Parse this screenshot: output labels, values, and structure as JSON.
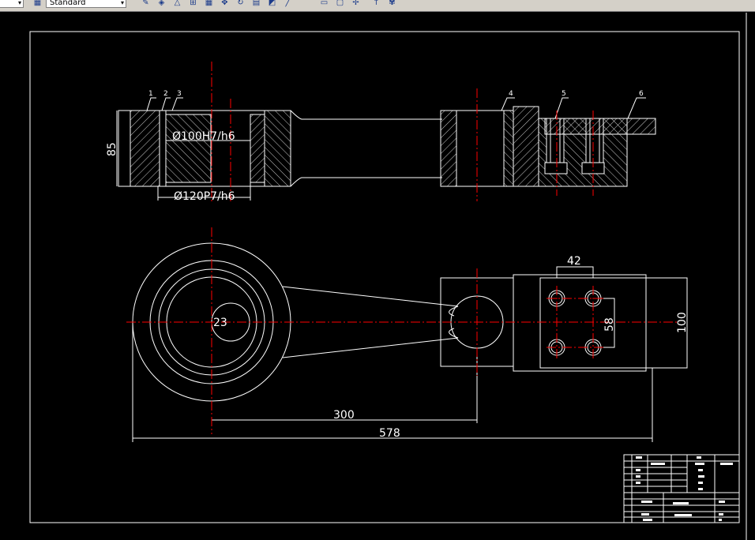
{
  "toolbar": {
    "left_combo_arrow": "▾",
    "style_combo_value": "Standard",
    "style_combo_arrow": "▾",
    "buttons": [
      {
        "icon": "pencil-icon",
        "glyph": "✎"
      },
      {
        "icon": "layer-icon",
        "glyph": "◈"
      },
      {
        "icon": "triangle-icon",
        "glyph": "△"
      },
      {
        "icon": "table-icon",
        "glyph": "⊞"
      },
      {
        "icon": "grid-icon",
        "glyph": "▦"
      },
      {
        "icon": "move-icon",
        "glyph": "✥"
      },
      {
        "icon": "rotate-icon",
        "glyph": "↻"
      },
      {
        "icon": "block-icon",
        "glyph": "▤"
      },
      {
        "icon": "scale-icon",
        "glyph": "◩"
      },
      {
        "icon": "line-icon",
        "glyph": "╱"
      },
      {
        "icon": "arc-icon",
        "glyph": "⌒"
      },
      {
        "icon": "rect-icon",
        "glyph": "▭"
      },
      {
        "icon": "rect2-icon",
        "glyph": "▢"
      },
      {
        "icon": "node-icon",
        "glyph": "✢"
      },
      {
        "icon": "pin-icon",
        "glyph": "↑"
      },
      {
        "icon": "paint-icon",
        "glyph": "✾"
      }
    ]
  },
  "drawing": {
    "part_labels": [
      "1",
      "2",
      "3",
      "4",
      "5",
      "6"
    ],
    "dim_height_85": "85",
    "dim_bore_100": "Ø100H7/h6",
    "dim_bore_120": "Ø120P7/h6",
    "dim_42": "42",
    "dim_58": "58",
    "dim_100": "100",
    "dim_23": "23",
    "dim_300": "300",
    "dim_578": "578"
  },
  "colors": {
    "background": "#000000",
    "lines": "#ffffff",
    "centerlines": "#ff0000",
    "toolbar": "#d4d0c8"
  }
}
